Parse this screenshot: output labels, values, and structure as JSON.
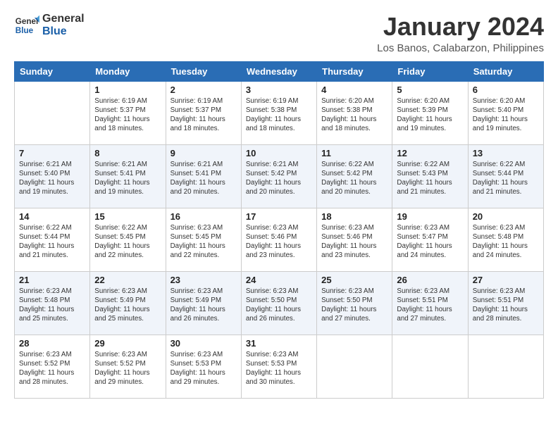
{
  "header": {
    "logo": {
      "line1": "General",
      "line2": "Blue"
    },
    "title": "January 2024",
    "location": "Los Banos, Calabarzon, Philippines"
  },
  "columns": [
    "Sunday",
    "Monday",
    "Tuesday",
    "Wednesday",
    "Thursday",
    "Friday",
    "Saturday"
  ],
  "weeks": [
    [
      {
        "day": "",
        "sunrise": "",
        "sunset": "",
        "daylight": ""
      },
      {
        "day": "1",
        "sunrise": "Sunrise: 6:19 AM",
        "sunset": "Sunset: 5:37 PM",
        "daylight": "Daylight: 11 hours and 18 minutes."
      },
      {
        "day": "2",
        "sunrise": "Sunrise: 6:19 AM",
        "sunset": "Sunset: 5:37 PM",
        "daylight": "Daylight: 11 hours and 18 minutes."
      },
      {
        "day": "3",
        "sunrise": "Sunrise: 6:19 AM",
        "sunset": "Sunset: 5:38 PM",
        "daylight": "Daylight: 11 hours and 18 minutes."
      },
      {
        "day": "4",
        "sunrise": "Sunrise: 6:20 AM",
        "sunset": "Sunset: 5:38 PM",
        "daylight": "Daylight: 11 hours and 18 minutes."
      },
      {
        "day": "5",
        "sunrise": "Sunrise: 6:20 AM",
        "sunset": "Sunset: 5:39 PM",
        "daylight": "Daylight: 11 hours and 19 minutes."
      },
      {
        "day": "6",
        "sunrise": "Sunrise: 6:20 AM",
        "sunset": "Sunset: 5:40 PM",
        "daylight": "Daylight: 11 hours and 19 minutes."
      }
    ],
    [
      {
        "day": "7",
        "sunrise": "Sunrise: 6:21 AM",
        "sunset": "Sunset: 5:40 PM",
        "daylight": "Daylight: 11 hours and 19 minutes."
      },
      {
        "day": "8",
        "sunrise": "Sunrise: 6:21 AM",
        "sunset": "Sunset: 5:41 PM",
        "daylight": "Daylight: 11 hours and 19 minutes."
      },
      {
        "day": "9",
        "sunrise": "Sunrise: 6:21 AM",
        "sunset": "Sunset: 5:41 PM",
        "daylight": "Daylight: 11 hours and 20 minutes."
      },
      {
        "day": "10",
        "sunrise": "Sunrise: 6:21 AM",
        "sunset": "Sunset: 5:42 PM",
        "daylight": "Daylight: 11 hours and 20 minutes."
      },
      {
        "day": "11",
        "sunrise": "Sunrise: 6:22 AM",
        "sunset": "Sunset: 5:42 PM",
        "daylight": "Daylight: 11 hours and 20 minutes."
      },
      {
        "day": "12",
        "sunrise": "Sunrise: 6:22 AM",
        "sunset": "Sunset: 5:43 PM",
        "daylight": "Daylight: 11 hours and 21 minutes."
      },
      {
        "day": "13",
        "sunrise": "Sunrise: 6:22 AM",
        "sunset": "Sunset: 5:44 PM",
        "daylight": "Daylight: 11 hours and 21 minutes."
      }
    ],
    [
      {
        "day": "14",
        "sunrise": "Sunrise: 6:22 AM",
        "sunset": "Sunset: 5:44 PM",
        "daylight": "Daylight: 11 hours and 21 minutes."
      },
      {
        "day": "15",
        "sunrise": "Sunrise: 6:22 AM",
        "sunset": "Sunset: 5:45 PM",
        "daylight": "Daylight: 11 hours and 22 minutes."
      },
      {
        "day": "16",
        "sunrise": "Sunrise: 6:23 AM",
        "sunset": "Sunset: 5:45 PM",
        "daylight": "Daylight: 11 hours and 22 minutes."
      },
      {
        "day": "17",
        "sunrise": "Sunrise: 6:23 AM",
        "sunset": "Sunset: 5:46 PM",
        "daylight": "Daylight: 11 hours and 23 minutes."
      },
      {
        "day": "18",
        "sunrise": "Sunrise: 6:23 AM",
        "sunset": "Sunset: 5:46 PM",
        "daylight": "Daylight: 11 hours and 23 minutes."
      },
      {
        "day": "19",
        "sunrise": "Sunrise: 6:23 AM",
        "sunset": "Sunset: 5:47 PM",
        "daylight": "Daylight: 11 hours and 24 minutes."
      },
      {
        "day": "20",
        "sunrise": "Sunrise: 6:23 AM",
        "sunset": "Sunset: 5:48 PM",
        "daylight": "Daylight: 11 hours and 24 minutes."
      }
    ],
    [
      {
        "day": "21",
        "sunrise": "Sunrise: 6:23 AM",
        "sunset": "Sunset: 5:48 PM",
        "daylight": "Daylight: 11 hours and 25 minutes."
      },
      {
        "day": "22",
        "sunrise": "Sunrise: 6:23 AM",
        "sunset": "Sunset: 5:49 PM",
        "daylight": "Daylight: 11 hours and 25 minutes."
      },
      {
        "day": "23",
        "sunrise": "Sunrise: 6:23 AM",
        "sunset": "Sunset: 5:49 PM",
        "daylight": "Daylight: 11 hours and 26 minutes."
      },
      {
        "day": "24",
        "sunrise": "Sunrise: 6:23 AM",
        "sunset": "Sunset: 5:50 PM",
        "daylight": "Daylight: 11 hours and 26 minutes."
      },
      {
        "day": "25",
        "sunrise": "Sunrise: 6:23 AM",
        "sunset": "Sunset: 5:50 PM",
        "daylight": "Daylight: 11 hours and 27 minutes."
      },
      {
        "day": "26",
        "sunrise": "Sunrise: 6:23 AM",
        "sunset": "Sunset: 5:51 PM",
        "daylight": "Daylight: 11 hours and 27 minutes."
      },
      {
        "day": "27",
        "sunrise": "Sunrise: 6:23 AM",
        "sunset": "Sunset: 5:51 PM",
        "daylight": "Daylight: 11 hours and 28 minutes."
      }
    ],
    [
      {
        "day": "28",
        "sunrise": "Sunrise: 6:23 AM",
        "sunset": "Sunset: 5:52 PM",
        "daylight": "Daylight: 11 hours and 28 minutes."
      },
      {
        "day": "29",
        "sunrise": "Sunrise: 6:23 AM",
        "sunset": "Sunset: 5:52 PM",
        "daylight": "Daylight: 11 hours and 29 minutes."
      },
      {
        "day": "30",
        "sunrise": "Sunrise: 6:23 AM",
        "sunset": "Sunset: 5:53 PM",
        "daylight": "Daylight: 11 hours and 29 minutes."
      },
      {
        "day": "31",
        "sunrise": "Sunrise: 6:23 AM",
        "sunset": "Sunset: 5:53 PM",
        "daylight": "Daylight: 11 hours and 30 minutes."
      },
      {
        "day": "",
        "sunrise": "",
        "sunset": "",
        "daylight": ""
      },
      {
        "day": "",
        "sunrise": "",
        "sunset": "",
        "daylight": ""
      },
      {
        "day": "",
        "sunrise": "",
        "sunset": "",
        "daylight": ""
      }
    ]
  ]
}
